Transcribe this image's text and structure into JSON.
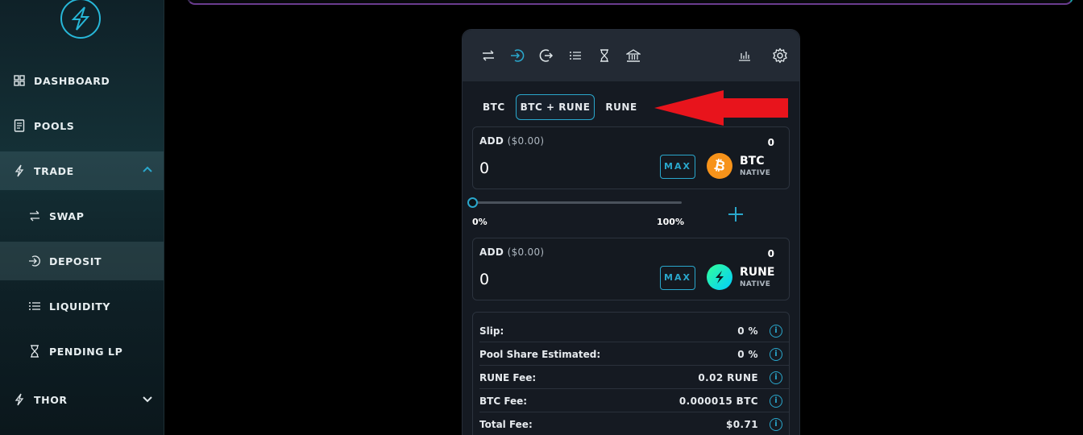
{
  "sidebar": {
    "items": [
      {
        "label": "DASHBOARD",
        "icon": "grid-icon"
      },
      {
        "label": "POOLS",
        "icon": "document-icon"
      },
      {
        "label": "TRADE",
        "icon": "bolt-icon"
      },
      {
        "label": "SWAP",
        "icon": "swap-icon"
      },
      {
        "label": "DEPOSIT",
        "icon": "deposit-icon"
      },
      {
        "label": "LIQUIDITY",
        "icon": "list-icon"
      },
      {
        "label": "PENDING LP",
        "icon": "hourglass-icon"
      },
      {
        "label": "THOR",
        "icon": "bolt-icon"
      }
    ]
  },
  "tabs": [
    {
      "label": "BTC"
    },
    {
      "label": "BTC + RUNE",
      "selected": true
    },
    {
      "label": "RUNE"
    }
  ],
  "inputs": [
    {
      "label": "ADD",
      "usd": "($0.00)",
      "balance": "0",
      "value": "0",
      "max_label": "MAX",
      "asset": "BTC",
      "type": "NATIVE"
    },
    {
      "label": "ADD",
      "usd": "($0.00)",
      "balance": "0",
      "value": "0",
      "max_label": "MAX",
      "asset": "RUNE",
      "type": "NATIVE"
    }
  ],
  "slider": {
    "min_label": "0%",
    "max_label": "100%",
    "value": 0
  },
  "stats": [
    {
      "key": "Slip:",
      "value": "0 %"
    },
    {
      "key": "Pool Share Estimated:",
      "value": "0 %"
    },
    {
      "key": "RUNE Fee:",
      "value": "0.02 RUNE"
    },
    {
      "key": "BTC Fee:",
      "value": "0.000015 BTC"
    },
    {
      "key": "Total Fee:",
      "value": "$0.71"
    }
  ],
  "colors": {
    "accent": "#2aa7cc",
    "btc": "#f7931a",
    "rune": "#23dcc8",
    "arrow": "#e8141c"
  }
}
